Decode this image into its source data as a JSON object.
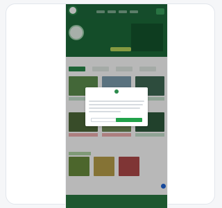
{
  "hero": {
    "headline": "",
    "cta_label": ""
  },
  "modal": {
    "title": "",
    "decline_label": "",
    "accept_label": ""
  },
  "section": {
    "title": ""
  },
  "colors": {
    "primary_green": "#1e6a3c",
    "accent_green": "#21a24a",
    "fab_blue": "#1f66d8"
  },
  "icons": {
    "logo": "soccer-ball-logo",
    "fab": "help-chat-icon"
  }
}
